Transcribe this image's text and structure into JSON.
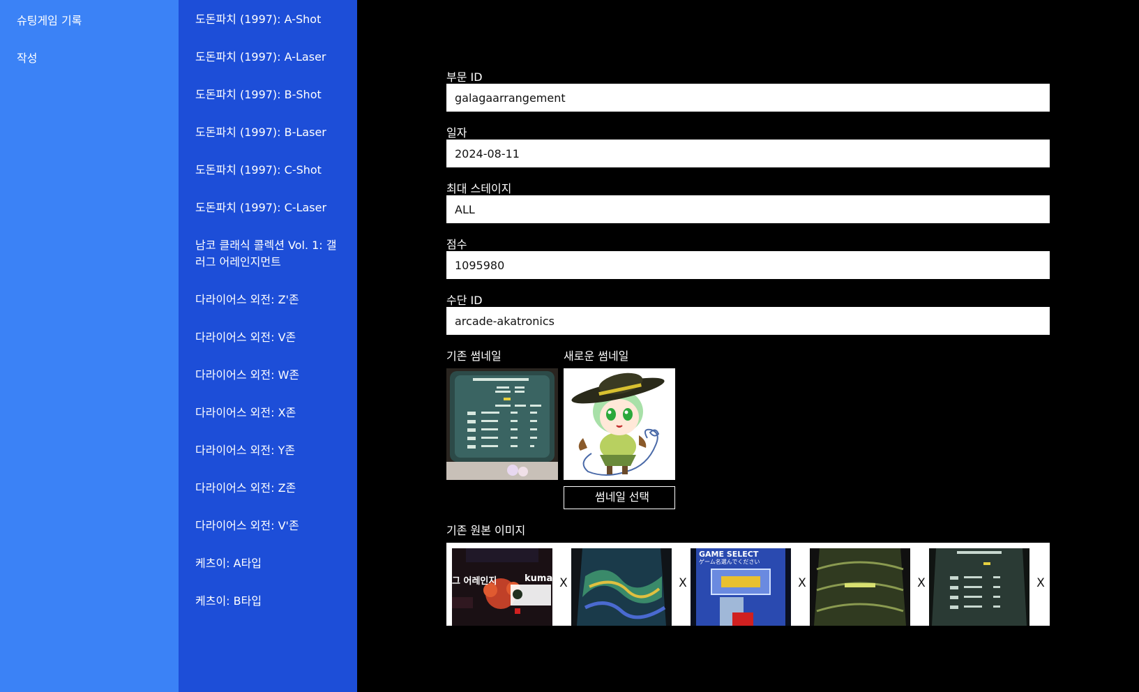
{
  "sidebar_main": {
    "items": [
      {
        "label": "슈팅게임 기록"
      },
      {
        "label": "작성"
      }
    ]
  },
  "sidebar_sub": {
    "items": [
      {
        "label": "도돈파치 (1997): A-Shot"
      },
      {
        "label": "도돈파치 (1997): A-Laser"
      },
      {
        "label": "도돈파치 (1997): B-Shot"
      },
      {
        "label": "도돈파치 (1997): B-Laser"
      },
      {
        "label": "도돈파치 (1997): C-Shot"
      },
      {
        "label": "도돈파치 (1997): C-Laser"
      },
      {
        "label": "남코 클래식 콜렉션 Vol. 1: 갤러그 어레인지먼트"
      },
      {
        "label": "다라이어스 외전: Z'존"
      },
      {
        "label": "다라이어스 외전: V존"
      },
      {
        "label": "다라이어스 외전: W존"
      },
      {
        "label": "다라이어스 외전: X존"
      },
      {
        "label": "다라이어스 외전: Y존"
      },
      {
        "label": "다라이어스 외전: Z존"
      },
      {
        "label": "다라이어스 외전: V'존"
      },
      {
        "label": "케츠이: A타입"
      },
      {
        "label": "케츠이: B타입"
      }
    ]
  },
  "form": {
    "division_id": {
      "label": "부문 ID",
      "value": "galagaarrangement"
    },
    "date": {
      "label": "일자",
      "value": "2024-08-11"
    },
    "max_stage": {
      "label": "최대 스테이지",
      "value": "ALL"
    },
    "score": {
      "label": "점수",
      "value": "1095980"
    },
    "method_id": {
      "label": "수단 ID",
      "value": "arcade-akatronics"
    }
  },
  "thumbnails": {
    "existing_label": "기존 썸네일",
    "new_label": "새로운 썸네일",
    "select_button": "썸네일 선택"
  },
  "original_images": {
    "label": "기존 원본 이미지",
    "remove_label": "X",
    "overlay_texts": [
      "그 어레인지",
      "kuman",
      "GAME SELECT",
      "ゲーム名選んでください"
    ]
  },
  "colors": {
    "sidebar_main_bg": "#3b82f6",
    "sidebar_sub_bg": "#1d4ed8",
    "content_bg": "#000000"
  }
}
